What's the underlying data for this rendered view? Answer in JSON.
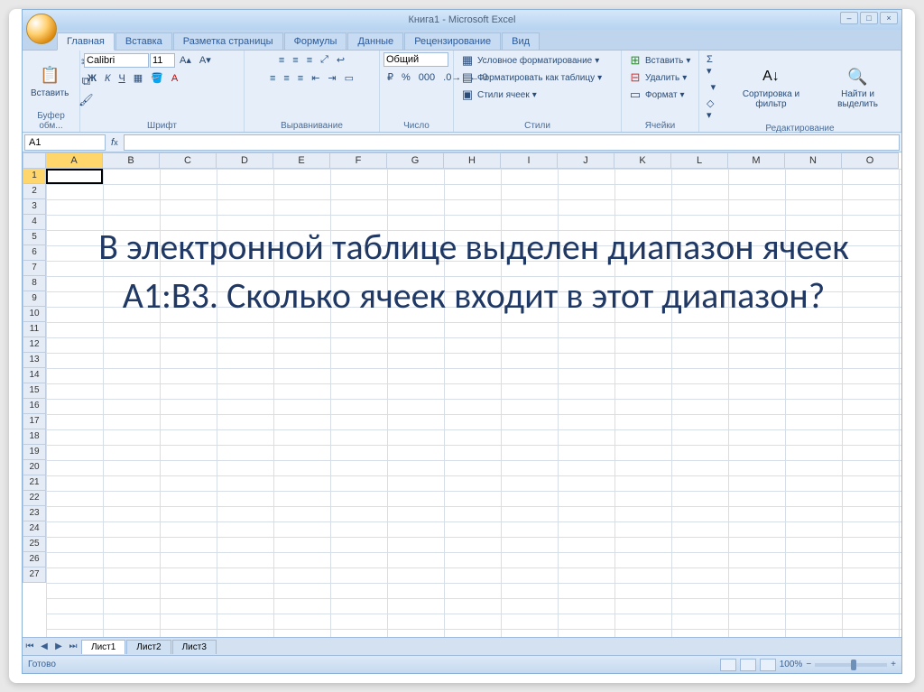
{
  "title": "Книга1 - Microsoft Excel",
  "tabs": [
    "Главная",
    "Вставка",
    "Разметка страницы",
    "Формулы",
    "Данные",
    "Рецензирование",
    "Вид"
  ],
  "activeTab": 0,
  "ribbon": {
    "clipboard": {
      "paste": "Вставить",
      "label": "Буфер обм..."
    },
    "font": {
      "name": "Calibri",
      "size": "11",
      "label": "Шрифт"
    },
    "align": {
      "label": "Выравнивание"
    },
    "number": {
      "format": "Общий",
      "label": "Число"
    },
    "styles": {
      "cond": "Условное форматирование",
      "table": "Форматировать как таблицу",
      "cell": "Стили ячеек",
      "label": "Стили"
    },
    "cells": {
      "insert": "Вставить",
      "delete": "Удалить",
      "format": "Формат",
      "label": "Ячейки"
    },
    "editing": {
      "sort": "Сортировка и фильтр",
      "find": "Найти и выделить",
      "label": "Редактирование"
    }
  },
  "namebox": "A1",
  "columns": [
    "A",
    "B",
    "C",
    "D",
    "E",
    "F",
    "G",
    "H",
    "I",
    "J",
    "K",
    "L",
    "M",
    "N",
    "O"
  ],
  "rows": [
    "1",
    "2",
    "3",
    "4",
    "5",
    "6",
    "7",
    "8",
    "9",
    "10",
    "11",
    "12",
    "13",
    "14",
    "15",
    "16",
    "17",
    "18",
    "19",
    "20",
    "21",
    "22",
    "23",
    "24",
    "25",
    "26",
    "27"
  ],
  "overlay": "В электронной таблице выделен диапазон ячеек A1:B3. Сколько ячеек входит в этот диапазон?",
  "sheetTabs": [
    "Лист1",
    "Лист2",
    "Лист3"
  ],
  "status": "Готово",
  "zoom": "100%"
}
